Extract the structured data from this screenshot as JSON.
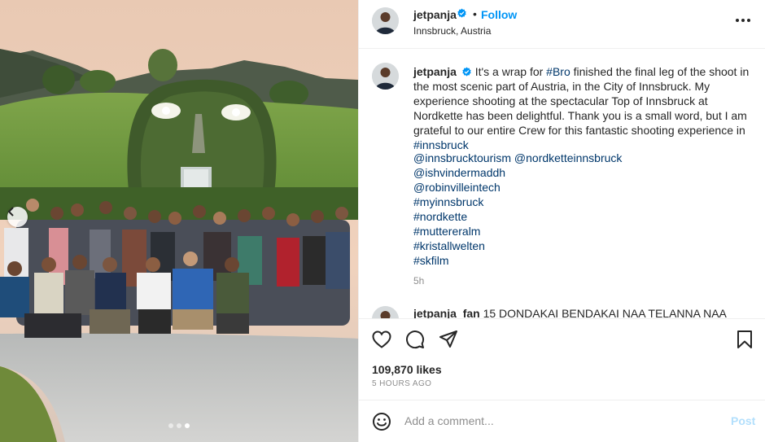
{
  "post": {
    "username": "jetpanja",
    "follow_label": "Follow",
    "separator": "•",
    "location": "Innsbruck, Austria",
    "caption": {
      "username": "jetpanja",
      "text_before": "It's a wrap for ",
      "hashtag_bro": "#Bro",
      "text_after": " finished the final leg of the shoot in the most scenic part of Austria, in the City of Innsbruck. My experience shooting at the spectacular Top of Innsbruck at Nordkette has been delightful. Thank you is a small word, but I am grateful to our entire Crew for this fantastic shooting experience in ",
      "hashtag_innsbruck": "#innsbruck"
    },
    "tags": [
      "@innsbrucktourism @nordketteinnsbruck",
      "@ishvindermaddh",
      "@robinvilleintech",
      "#myinnsbruck",
      "#nordkette",
      "#muttereralm",
      "#kristallwelten",
      "#skfilm"
    ],
    "time": "5h",
    "next_comment": {
      "username": "jetpanja_fan",
      "text": "15 DONDAKAI BENDAKAI NAA TELANNA NAA"
    },
    "likes": "109,870 likes",
    "posted_ago": "5 HOURS AGO",
    "comment_placeholder": "Add a comment...",
    "post_label": "Post"
  },
  "carousel": {
    "count": 3,
    "active_index": 2
  },
  "icons": {
    "verified": "verified-badge-icon",
    "more": "more-options-icon",
    "like": "heart-icon",
    "comment": "comment-icon",
    "share": "send-icon",
    "save": "bookmark-icon",
    "emoji": "emoji-icon",
    "prev": "chevron-left-icon"
  },
  "colors": {
    "link": "#00376b",
    "accent": "#0095f6",
    "verified": "#0095f6",
    "post_disabled": "#b2dffc",
    "secondary_text": "#8e8e8e"
  }
}
